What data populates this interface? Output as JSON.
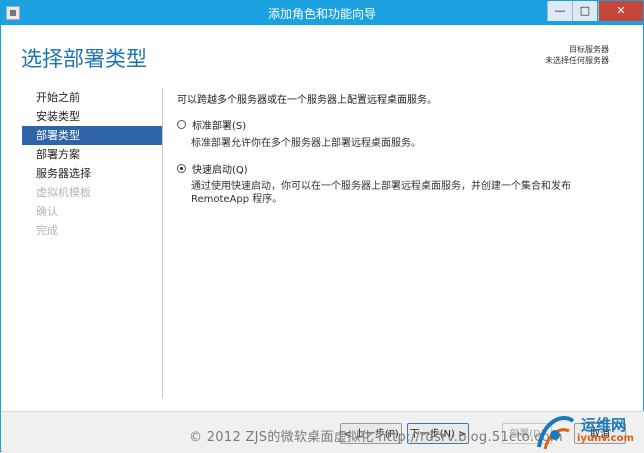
{
  "window": {
    "title": "添加角色和功能向导",
    "controls": {
      "minimize": "—",
      "maximize": "□",
      "close": "✕"
    }
  },
  "header": {
    "page_title": "选择部署类型",
    "target_server_label": "目标服务器",
    "target_server_value": "未选择任何服务器"
  },
  "sidebar": {
    "items": [
      {
        "label": "开始之前",
        "state": "normal"
      },
      {
        "label": "安装类型",
        "state": "normal"
      },
      {
        "label": "部署类型",
        "state": "active"
      },
      {
        "label": "部署方案",
        "state": "normal"
      },
      {
        "label": "服务器选择",
        "state": "normal"
      },
      {
        "label": "虚拟机模板",
        "state": "disabled"
      },
      {
        "label": "确认",
        "state": "disabled"
      },
      {
        "label": "完成",
        "state": "disabled"
      }
    ]
  },
  "content": {
    "intro": "可以跨越多个服务器或在一个服务器上配置远程桌面服务。",
    "options": [
      {
        "label": "标准部署(S)",
        "checked": false,
        "description": "标准部署允许你在多个服务器上部署远程桌面服务。"
      },
      {
        "label": "快速启动(Q)",
        "checked": true,
        "description": "通过使用快速启动，你可以在一个服务器上部署远程桌面服务，并创建一个集合和发布 RemoteApp 程序。"
      }
    ]
  },
  "footer": {
    "prev_label": "< 上一步(P)",
    "next_label": "下一步(N) >",
    "deploy_label": "部署(D)",
    "cancel_label": "取消"
  },
  "overlay": {
    "watermark": "© 2012 ZJS的微软桌面虚拟化 http://rdsrv.blog.51cto.com",
    "logo_brand": "运维网",
    "logo_url": "iyunv.com"
  }
}
